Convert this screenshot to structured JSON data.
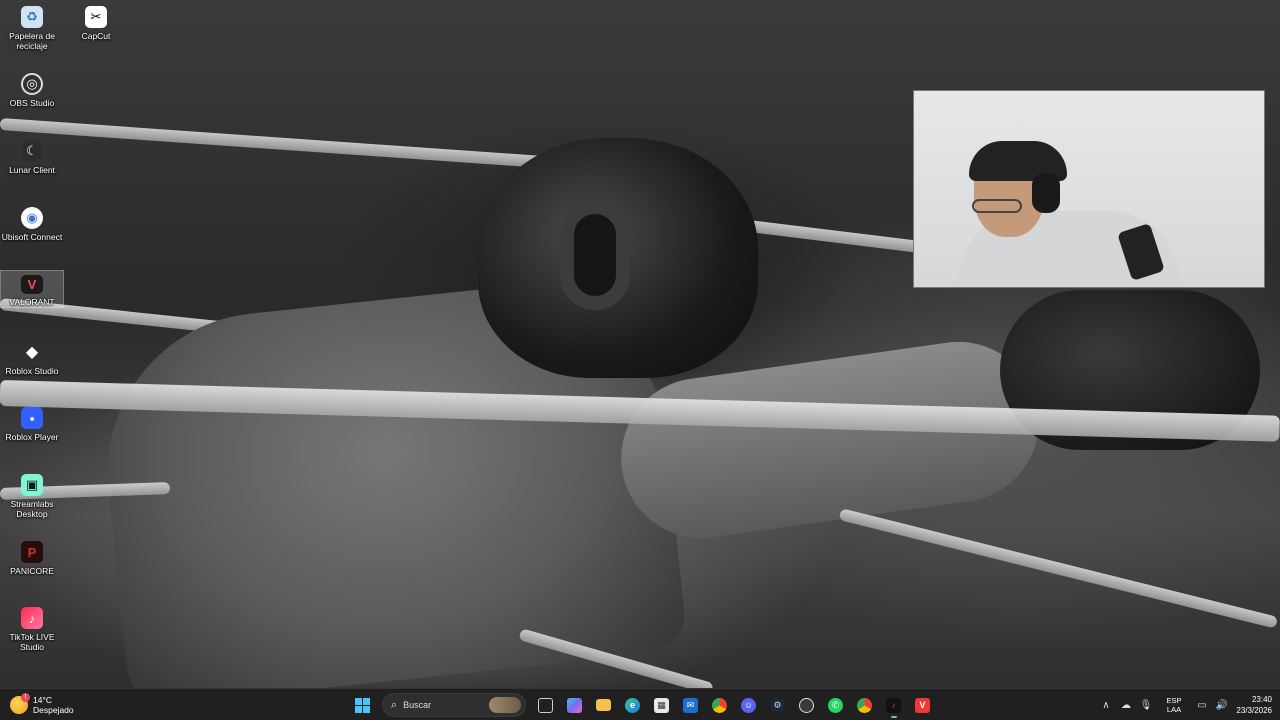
{
  "desktop": {
    "icons": [
      {
        "label": "Papelera de reciclaje",
        "icon": "recycle-bin-icon",
        "color": "#5b9bd5"
      },
      {
        "label": "CapCut",
        "icon": "capcut-icon",
        "color": "#ffffff"
      },
      {
        "label": "OBS Studio",
        "icon": "obs-icon",
        "color": "#303030"
      },
      {
        "label": "Lunar Client",
        "icon": "lunar-client-icon",
        "color": "#2c2c2c"
      },
      {
        "label": "Ubisoft Connect",
        "icon": "ubisoft-icon",
        "color": "#3a6fd8"
      },
      {
        "label": "VALORANT",
        "icon": "valorant-icon",
        "color": "#ff4655"
      },
      {
        "label": "Roblox Studio",
        "icon": "roblox-studio-icon",
        "color": "#ffffff"
      },
      {
        "label": "Roblox Player",
        "icon": "roblox-player-icon",
        "color": "#335fff"
      },
      {
        "label": "Streamlabs Desktop",
        "icon": "streamlabs-icon",
        "color": "#80f5d2"
      },
      {
        "label": "PANICORE",
        "icon": "panicore-icon",
        "color": "#8b1d1d"
      },
      {
        "label": "TikTok LIVE Studio",
        "icon": "tiktok-live-studio-icon",
        "color": "#fe2c55"
      }
    ]
  },
  "taskbar": {
    "weather": {
      "temp": "14°C",
      "condition": "Despejado",
      "icon": "weather-sun-icon"
    },
    "search_placeholder": "Buscar",
    "apps": [
      {
        "name": "start-button",
        "icon": "windows-start-icon",
        "color": "#4cc2ff",
        "glyph": "⊞"
      },
      {
        "name": "task-view-button",
        "icon": "task-view-icon",
        "color": "#cfcfcf",
        "glyph": "▢"
      },
      {
        "name": "copilot-button",
        "icon": "copilot-icon",
        "color": "#7a6cf0",
        "glyph": "✦"
      },
      {
        "name": "file-explorer-button",
        "icon": "folder-icon",
        "color": "#f2c14e",
        "glyph": "▬"
      },
      {
        "name": "edge-button",
        "icon": "edge-icon",
        "color": "#1fa1d8",
        "glyph": "e"
      },
      {
        "name": "store-button",
        "icon": "store-icon",
        "color": "#e8e8e8",
        "glyph": "▣"
      },
      {
        "name": "mail-button",
        "icon": "mail-icon",
        "color": "#1c6fd1",
        "glyph": "✉"
      },
      {
        "name": "chrome-button",
        "icon": "chrome-icon",
        "color": "#34a853",
        "glyph": "◉"
      },
      {
        "name": "discord-button",
        "icon": "discord-icon",
        "color": "#5865f2",
        "glyph": "◐"
      },
      {
        "name": "steam-button",
        "icon": "steam-icon",
        "color": "#1b2838",
        "glyph": "♨"
      },
      {
        "name": "obs-taskbar-button",
        "icon": "obs-icon",
        "color": "#3a3a3a",
        "glyph": "◎"
      },
      {
        "name": "whatsapp-button",
        "icon": "whatsapp-icon",
        "color": "#25d366",
        "glyph": "✆"
      },
      {
        "name": "chrome-profile-button",
        "icon": "chrome-icon",
        "color": "#ea4335",
        "glyph": "◉"
      },
      {
        "name": "tiktok-button",
        "icon": "tiktok-icon",
        "color": "#fe2c55",
        "glyph": "♪"
      },
      {
        "name": "vivaldi-button",
        "icon": "vivaldi-icon",
        "color": "#ef3939",
        "glyph": "V"
      }
    ],
    "tray": {
      "language_line1": "ESP",
      "language_line2": "LAA",
      "time": "23:40",
      "date": "23/3/2026"
    }
  }
}
